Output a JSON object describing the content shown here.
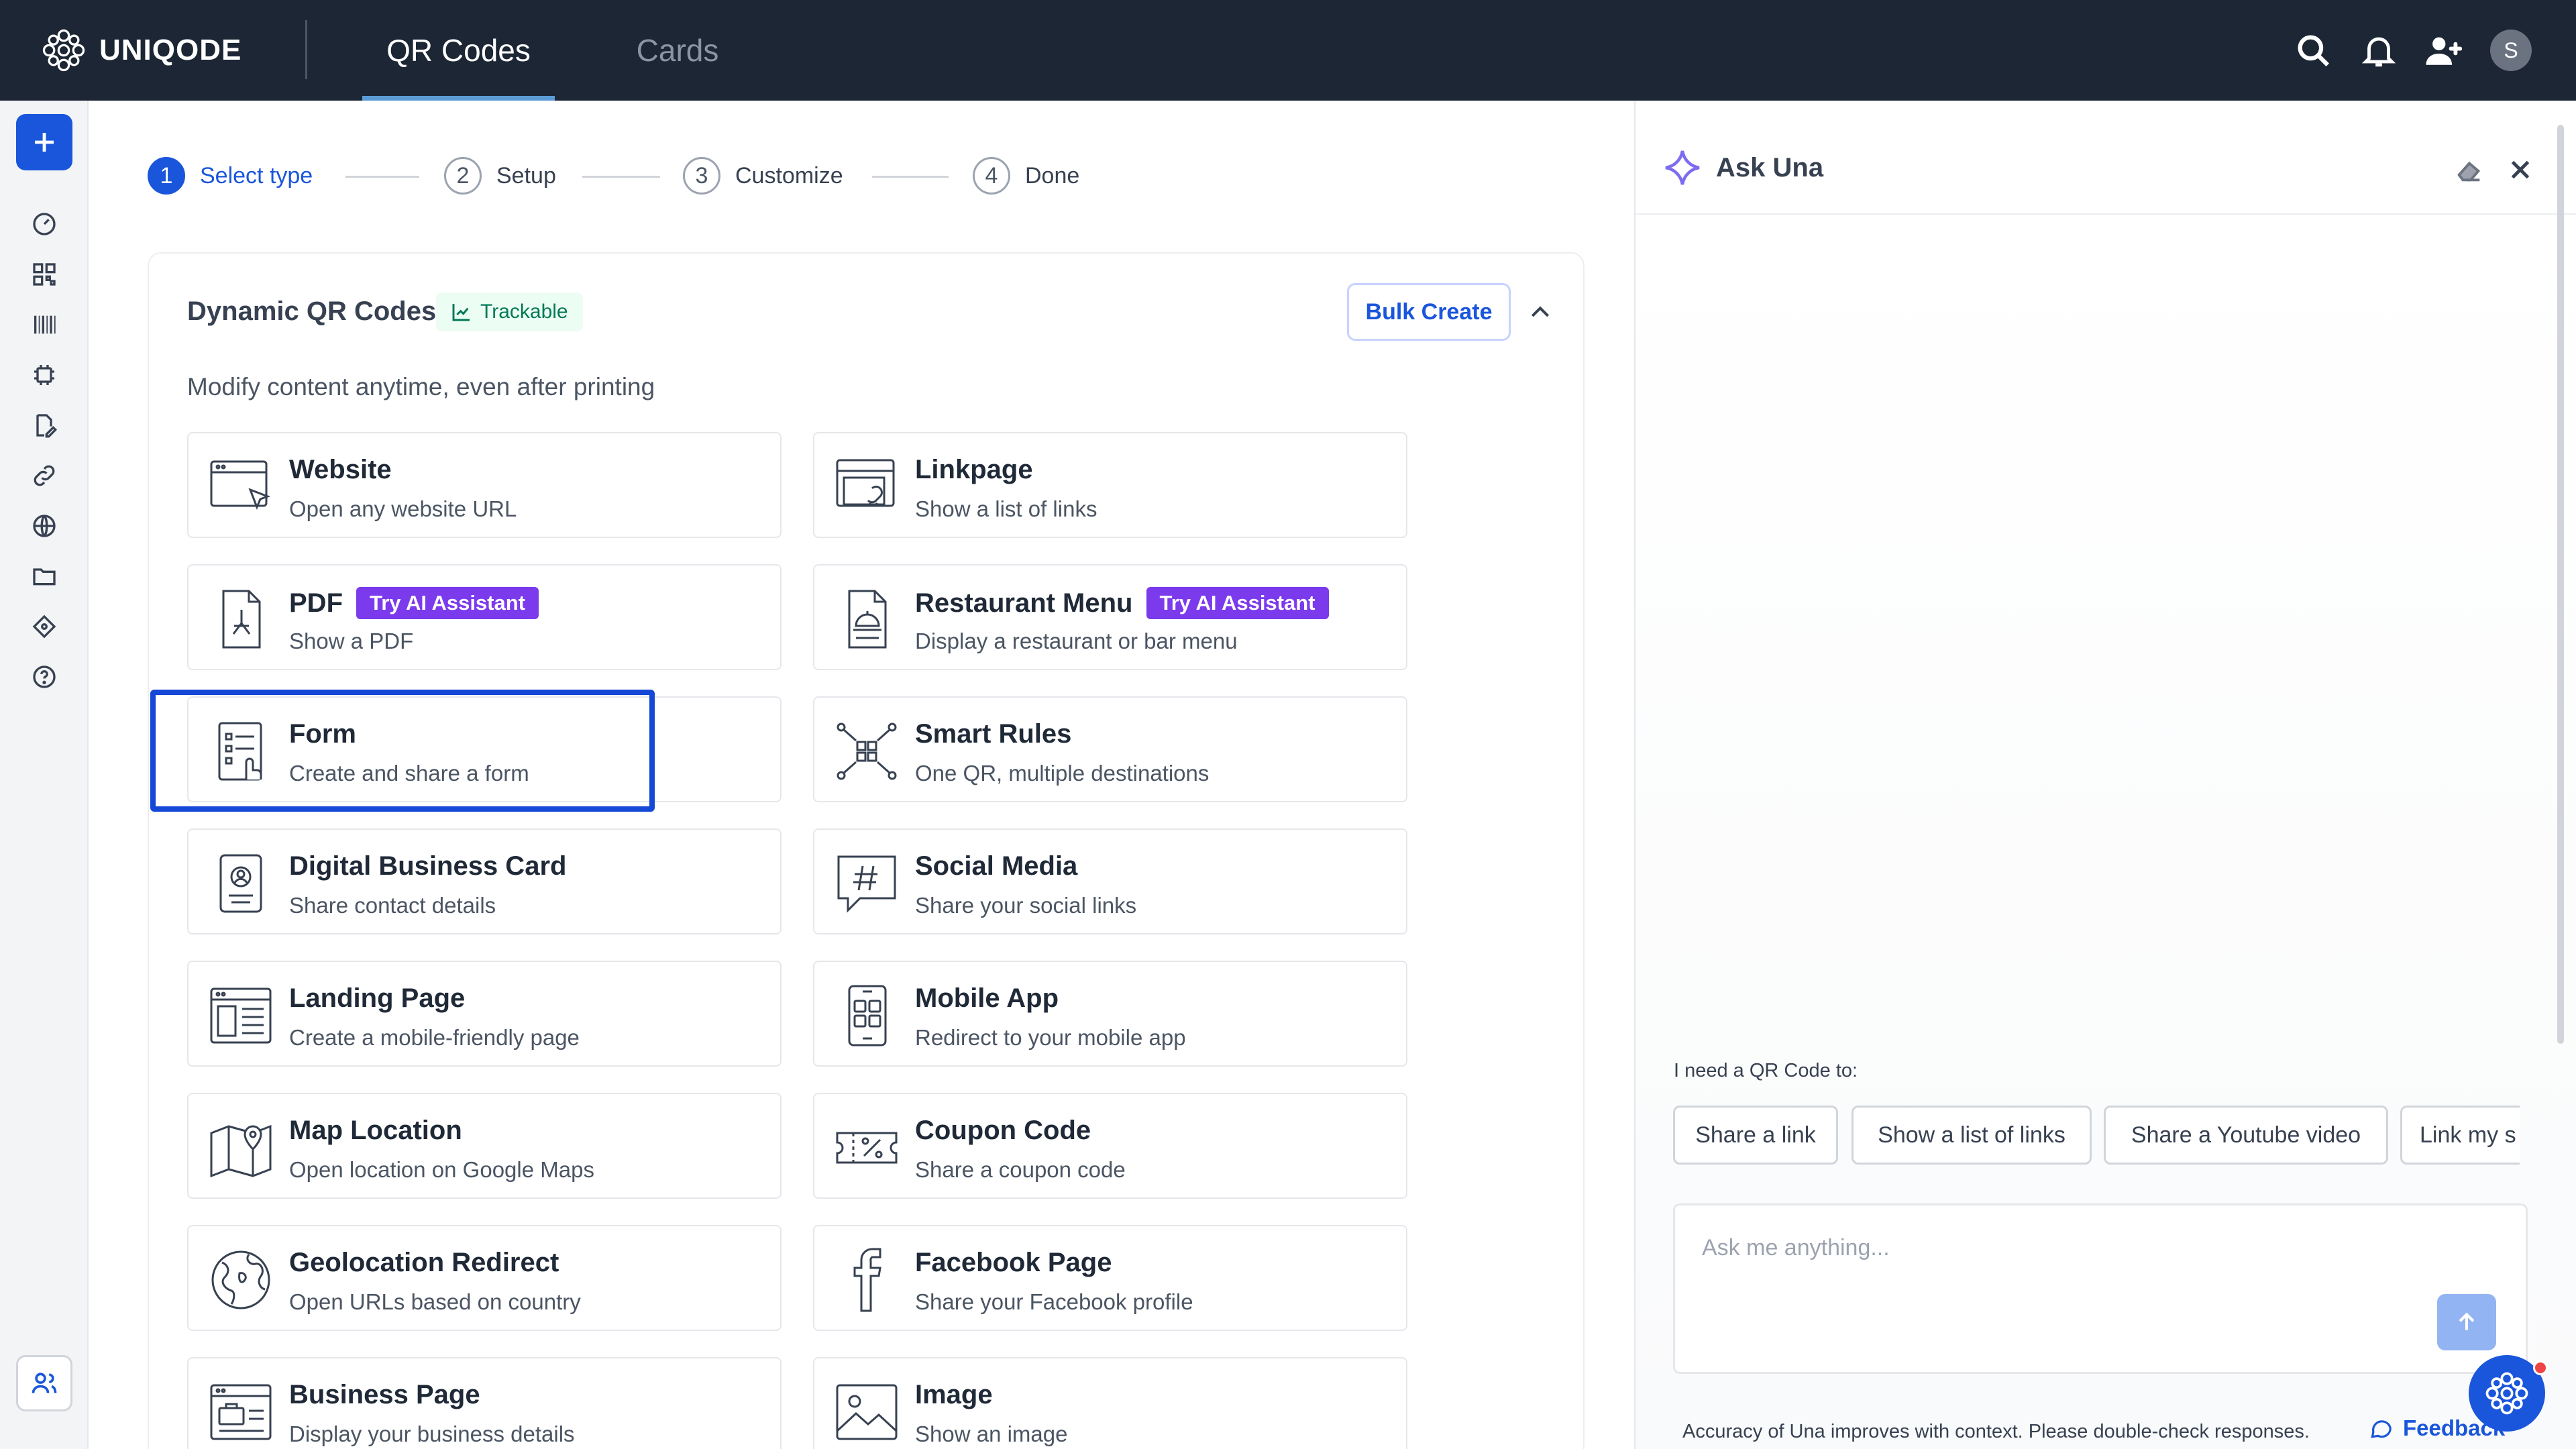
{
  "app": {
    "brand": "UNIQODE"
  },
  "nav": {
    "tabs": [
      {
        "label": "QR Codes"
      },
      {
        "label": "Cards"
      }
    ]
  },
  "user": {
    "initial": "S"
  },
  "stepper": {
    "steps": [
      {
        "num": "1",
        "label": "Select type"
      },
      {
        "num": "2",
        "label": "Setup"
      },
      {
        "num": "3",
        "label": "Customize"
      },
      {
        "num": "4",
        "label": "Done"
      }
    ]
  },
  "section": {
    "title": "Dynamic QR Codes",
    "badge": "Trackable",
    "bulk_label": "Bulk Create",
    "description": "Modify content anytime, even after printing"
  },
  "types": [
    {
      "title": "Website",
      "desc": "Open any website URL",
      "icon": "website-icon"
    },
    {
      "title": "Linkpage",
      "desc": "Show a list of links",
      "icon": "linkpage-icon"
    },
    {
      "title": "PDF",
      "desc": "Show a PDF",
      "badge": "Try AI Assistant",
      "icon": "pdf-icon"
    },
    {
      "title": "Restaurant Menu",
      "desc": "Display a restaurant or bar menu",
      "badge": "Try AI Assistant",
      "icon": "restaurant-menu-icon"
    },
    {
      "title": "Form",
      "desc": "Create and share a form",
      "icon": "form-icon"
    },
    {
      "title": "Smart Rules",
      "desc": "One QR, multiple destinations",
      "icon": "smart-rules-icon"
    },
    {
      "title": "Digital Business Card",
      "desc": "Share contact details",
      "icon": "business-card-icon"
    },
    {
      "title": "Social Media",
      "desc": "Share your social links",
      "icon": "hashtag-icon"
    },
    {
      "title": "Landing Page",
      "desc": "Create a mobile-friendly page",
      "icon": "landing-page-icon"
    },
    {
      "title": "Mobile App",
      "desc": "Redirect to your mobile app",
      "icon": "mobile-app-icon"
    },
    {
      "title": "Map Location",
      "desc": "Open location on Google Maps",
      "icon": "map-location-icon"
    },
    {
      "title": "Coupon Code",
      "desc": "Share a coupon code",
      "icon": "coupon-icon"
    },
    {
      "title": "Geolocation Redirect",
      "desc": "Open URLs based on country",
      "icon": "globe-icon"
    },
    {
      "title": "Facebook Page",
      "desc": "Share your Facebook profile",
      "icon": "facebook-icon"
    },
    {
      "title": "Business Page",
      "desc": "Display your business details",
      "icon": "business-page-icon"
    },
    {
      "title": "Image",
      "desc": "Show an image",
      "icon": "image-icon"
    }
  ],
  "una": {
    "title": "Ask Una",
    "prompt": "I need a QR Code to:",
    "chips": [
      "Share a link",
      "Show a list of links",
      "Share a Youtube video",
      "Link my s"
    ],
    "placeholder": "Ask me anything...",
    "footer": "Accuracy of Una improves with context. Please double-check responses.",
    "feedback": "Feedback"
  },
  "colors": {
    "topbar": "#1c2634",
    "accent": "#1a56db",
    "ai_badge": "#7c3aed",
    "trackable": "#047857"
  }
}
